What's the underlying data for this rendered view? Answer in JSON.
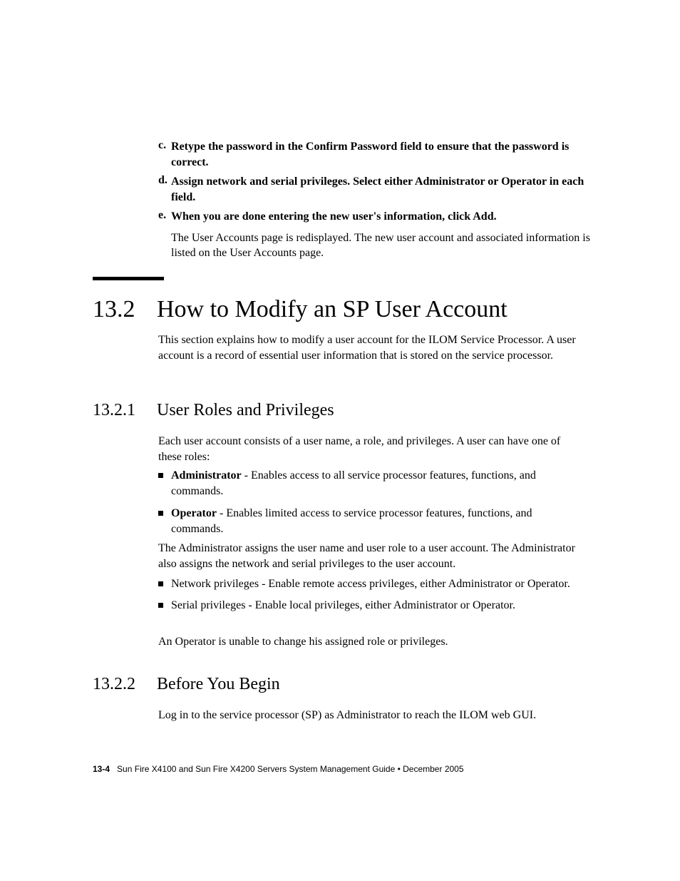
{
  "steps": {
    "c": {
      "letter": "c.",
      "text": "Retype the password in the Confirm Password field to ensure that the password is correct."
    },
    "d": {
      "letter": "d.",
      "text": "Assign network and serial privileges. Select either Administrator or Operator in each field."
    },
    "e": {
      "letter": "e.",
      "text": "When you are done entering the new user's information, click Add.",
      "desc": "The User Accounts page is redisplayed. The new user account and associated information is listed on the User Accounts page."
    }
  },
  "section_13_2": {
    "num": "13.2",
    "title": "How to Modify an SP User Account",
    "intro": "This section explains how to modify a user account for the ILOM Service Processor. A user account is a record of essential user information that is stored on the service processor."
  },
  "section_13_2_1": {
    "num": "13.2.1",
    "title": "User Roles and Privileges",
    "para1": "Each user account consists of a user name, a role, and privileges. A user can have one of these roles:",
    "roles": [
      {
        "bold": "Administrator",
        "rest": " - Enables access to all service processor features, functions, and commands."
      },
      {
        "bold": "Operator",
        "rest": " - Enables limited access to service processor features, functions, and commands."
      }
    ],
    "para2": "The Administrator assigns the user name and user role to a user account. The Administrator also assigns the network and serial privileges to the user account.",
    "privs": [
      "Network privileges - Enable remote access privileges, either Administrator or Operator.",
      "Serial privileges - Enable local privileges, either Administrator or Operator."
    ],
    "para3": "An Operator is unable to change his assigned role or privileges."
  },
  "section_13_2_2": {
    "num": "13.2.2",
    "title": "Before You Begin",
    "para1": "Log in to the service processor (SP) as Administrator to reach the ILOM web GUI."
  },
  "footer": {
    "page": "13-4",
    "text": "Sun Fire X4100 and Sun Fire X4200 Servers System Management Guide  •  December 2005"
  }
}
